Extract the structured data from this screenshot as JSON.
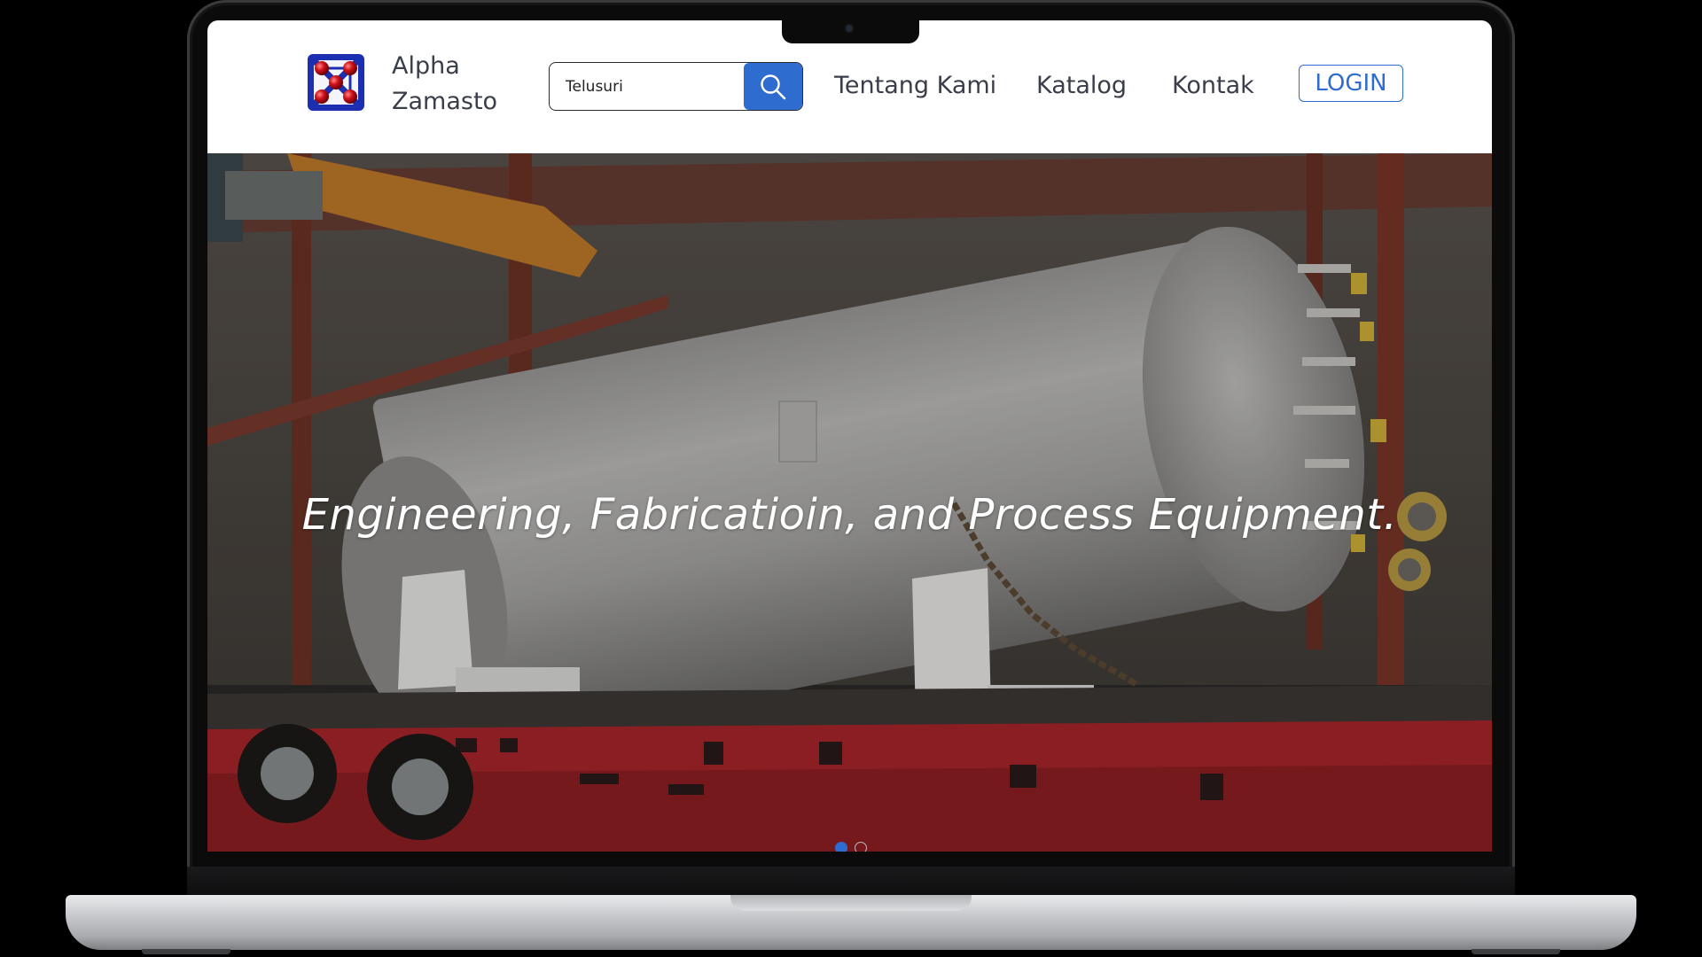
{
  "brand": {
    "line1": "Alpha",
    "line2": "Zamasto"
  },
  "search": {
    "placeholder": "Telusuri"
  },
  "nav": [
    {
      "label": "Tentang Kami"
    },
    {
      "label": "Katalog"
    },
    {
      "label": "Kontak"
    }
  ],
  "login": {
    "label": "LOGIN"
  },
  "hero": {
    "title": "Engineering, Fabricatioin, and Process Equipment.",
    "slides": {
      "total": 2,
      "active": 1
    }
  },
  "colors": {
    "accent": "#2f6ccf",
    "header_bg": "#ffffff",
    "trailer_red": "#b8262b"
  },
  "icons": [
    "logo-icon",
    "search-icon"
  ]
}
